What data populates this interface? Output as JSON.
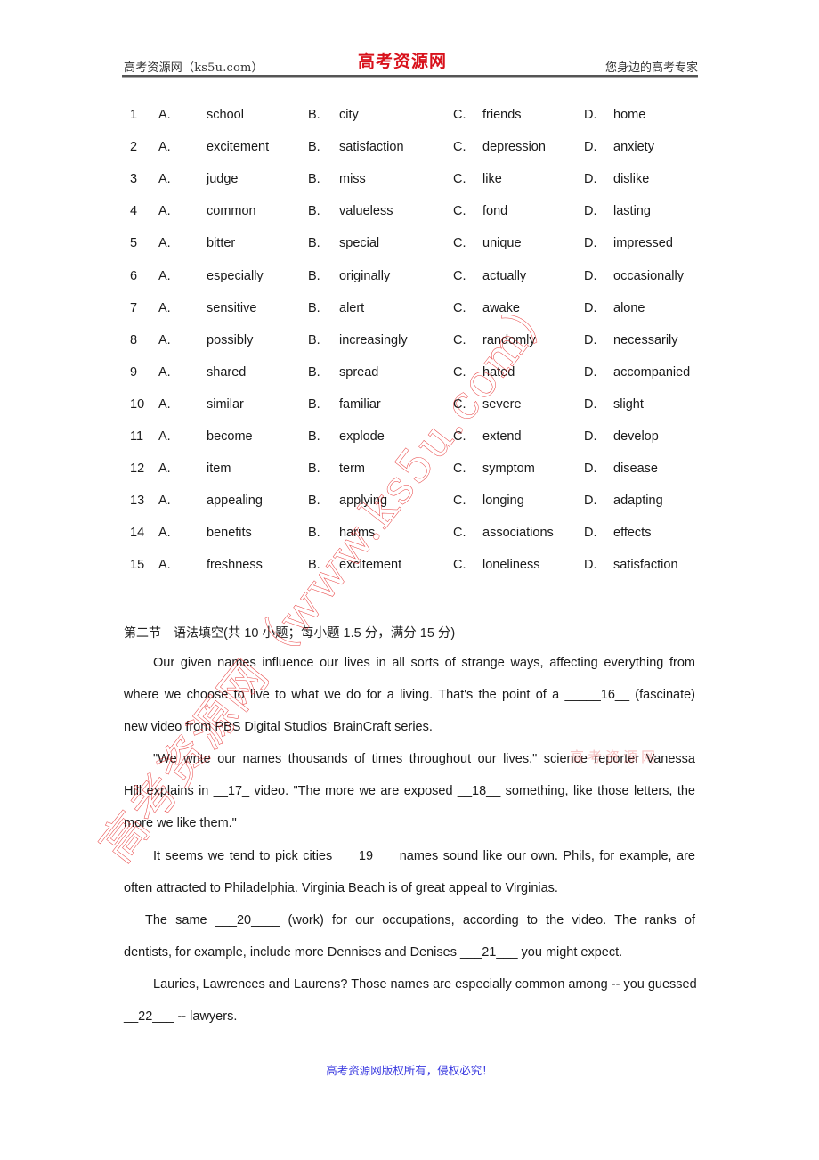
{
  "header": {
    "left": "高考资源网（ks5u.com）",
    "center_logo": "高考资源网",
    "right": "您身边的高考专家"
  },
  "options": [
    {
      "num": "1",
      "a": "school",
      "b": "city",
      "c": "friends",
      "d": "home"
    },
    {
      "num": "2",
      "a": "excitement",
      "b": "satisfaction",
      "c": "depression",
      "d": "anxiety"
    },
    {
      "num": "3",
      "a": "judge",
      "b": "miss",
      "c": "like",
      "d": "dislike"
    },
    {
      "num": "4",
      "a": "common",
      "b": "valueless",
      "c": "fond",
      "d": "lasting"
    },
    {
      "num": "5",
      "a": "bitter",
      "b": "special",
      "c": "unique",
      "d": "impressed"
    },
    {
      "num": "6",
      "a": "especially",
      "b": "originally",
      "c": "actually",
      "d": "occasionally"
    },
    {
      "num": "7",
      "a": "sensitive",
      "b": "alert",
      "c": "awake",
      "d": "alone"
    },
    {
      "num": "8",
      "a": "possibly",
      "b": "increasingly",
      "c": "randomly",
      "d": "necessarily"
    },
    {
      "num": "9",
      "a": "shared",
      "b": "spread",
      "c": "hated",
      "d": "accompanied"
    },
    {
      "num": "10",
      "a": "similar",
      "b": "familiar",
      "c": "severe",
      "d": "slight"
    },
    {
      "num": "11",
      "a": "become",
      "b": "explode",
      "c": "extend",
      "d": "develop"
    },
    {
      "num": "12",
      "a": "item",
      "b": "term",
      "c": "symptom",
      "d": "disease"
    },
    {
      "num": "13",
      "a": "appealing",
      "b": "applying",
      "c": "longing",
      "d": "adapting"
    },
    {
      "num": "14",
      "a": "benefits",
      "b": "harms",
      "c": "associations",
      "d": "effects"
    },
    {
      "num": "15",
      "a": "freshness",
      "b": "excitement",
      "c": "loneliness",
      "d": "satisfaction"
    }
  ],
  "option_letters": {
    "a": "A.",
    "b": "B.",
    "c": "C.",
    "d": "D."
  },
  "section2": {
    "title": "第二节　语法填空",
    "meta": "(共 10 小题；每小题 1.5 分，满分 15 分)",
    "lines": [
      "Our given names influence our lives in all sorts of strange ways, affecting everything from",
      "where we choose to live to what we do for a living. That's the point of a _____16__ (fascinate)",
      "new video from PBS Digital Studios' BrainCraft series.",
      "\"We write our names thousands of times throughout our lives,\" science reporter Vanessa",
      "Hill explains in __17_ video. \"The more we are exposed __18__ something, like those letters, the",
      "more we like them.\"",
      "It seems we tend to pick cities ___19___ names sound like our own. Phils, for example, are",
      "often attracted to Philadelphia. Virginia Beach is of great appeal to Virginias.",
      "The same ___20____ (work) for our occupations, according to the video. The ranks of",
      "dentists, for example, include more Dennises and Denises ___21___ you might expect.",
      "Lauries, Lawrences and Laurens? Those names are especially common among -- you guessed",
      "__22___ -- lawyers."
    ]
  },
  "footer": {
    "text": "高考资源网版权所有，侵权必究！"
  },
  "watermark": {
    "main": "高考资源网（www.ks5u.com）",
    "faint": "高考资源网"
  }
}
